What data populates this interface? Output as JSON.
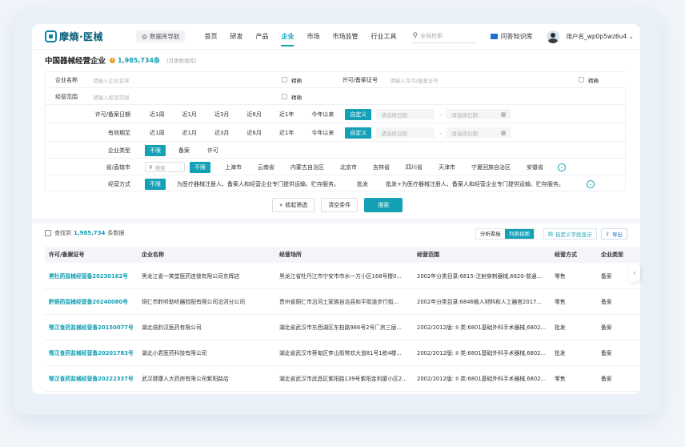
{
  "header": {
    "logo": "摩熵·医械",
    "db_nav": "数据库导航",
    "nav": [
      "首页",
      "研发",
      "产品",
      "企业",
      "市场",
      "市场监管",
      "行业工具"
    ],
    "active_nav": "企业",
    "search_placeholder": "全局检索",
    "knowledge": "问答知识库",
    "username": "用户名_wp0p5wz6u4 ⌄"
  },
  "title": {
    "text": "中国器械经营企业",
    "count": "1,985,734条",
    "note": "(月更数据库)"
  },
  "filters": {
    "company_name_label": "企业名称",
    "company_name_ph": "请输入企业名称",
    "exact": "精确",
    "license_label": "许可/备案证号",
    "license_ph": "请输入许可/备案证号",
    "scope_label": "经营范围",
    "scope_ph": "请输入经营范围",
    "license_date_label": "许可/备案日期",
    "valid_until_label": "有效期至",
    "date_options": [
      "近1周",
      "近1月",
      "近3月",
      "近6月",
      "近1年",
      "今年以来",
      "自定义"
    ],
    "date_start_ph": "请选择日期",
    "date_end_ph": "请选择日期",
    "date_sep": "–",
    "type_label": "企业类型",
    "type_options": [
      "不限",
      "备案",
      "许可"
    ],
    "region_label": "省/直辖市",
    "region_search_ph": "搜索",
    "regions": [
      "不限",
      "上海市",
      "云南省",
      "内蒙古自治区",
      "北京市",
      "吉林省",
      "四川省",
      "天津市",
      "宁夏回族自治区",
      "安徽省"
    ],
    "mode_label": "经营方式",
    "modes": [
      "不限",
      "为医疗器械注册人、备案人和经营企业专门提供运输、贮存服务。",
      "批发",
      "批发+为医疗器械注册人、备案人和经营企业专门提供运输、贮存服务。"
    ]
  },
  "buttons": {
    "collapse": "收起筛选",
    "clear": "清空条件",
    "search": "搜索"
  },
  "results": {
    "found_prefix": "查找到",
    "found_count": "1,985,734",
    "found_suffix": "条数据",
    "view_analysis": "分析看板",
    "view_list": "列表视图",
    "custom_fields": "自定义字段显示",
    "export": "导出",
    "columns": [
      "许可/备案证号",
      "企业名称",
      "经营场所",
      "经营范围",
      "经营方式",
      "企业类型"
    ],
    "rows": [
      [
        "黑牡药监械经营备20230162号",
        "黑龙江省一笑堂医药连锁有限公司东辉店",
        "黑龙江省牡丹江市宁安市市水一方小区168号楼0...",
        "2002年分类目录:6815-注射穿刺器械,6820-普通...",
        "零售",
        "备案"
      ],
      [
        "黔铜药监械经营备20240080号",
        "铜仁市聆听助听器验配有限公司沿河分公司",
        "贵州省铜仁市沿河土家族自治县和平街道步行街...",
        "2002年分类目录:6846植入材料和人工器官2017...",
        "零售",
        "备案"
      ],
      [
        "鄂汉食药监械经营备20150077号",
        "湖北倍豹汉医药有限公司",
        "湖北省武汉市东西湖区东柏路986号2号厂房三层...",
        "2002/2012版: II 类:6801基础外科手术器械,6802...",
        "批发",
        "备案"
      ],
      [
        "鄂汉食药监械经营备20201783号",
        "湖北小君医药科技有限公司",
        "湖北省武汉市蔡甸区奓山街常欢大道81号1栋4楼...",
        "2002/2012版: II 类:6801基础外科手术器械,6802...",
        "批发",
        "备案"
      ],
      [
        "鄂汉食药监械经营备20222337号",
        "武汉健康人大药房有限公司紫阳路店",
        "湖北省武汉市武昌区紫阳路139号紫阳金利厦小区2栋1...",
        "2002/2012版: II 类:6801基础外科手术器械,6802...",
        "零售",
        "备案"
      ]
    ]
  }
}
